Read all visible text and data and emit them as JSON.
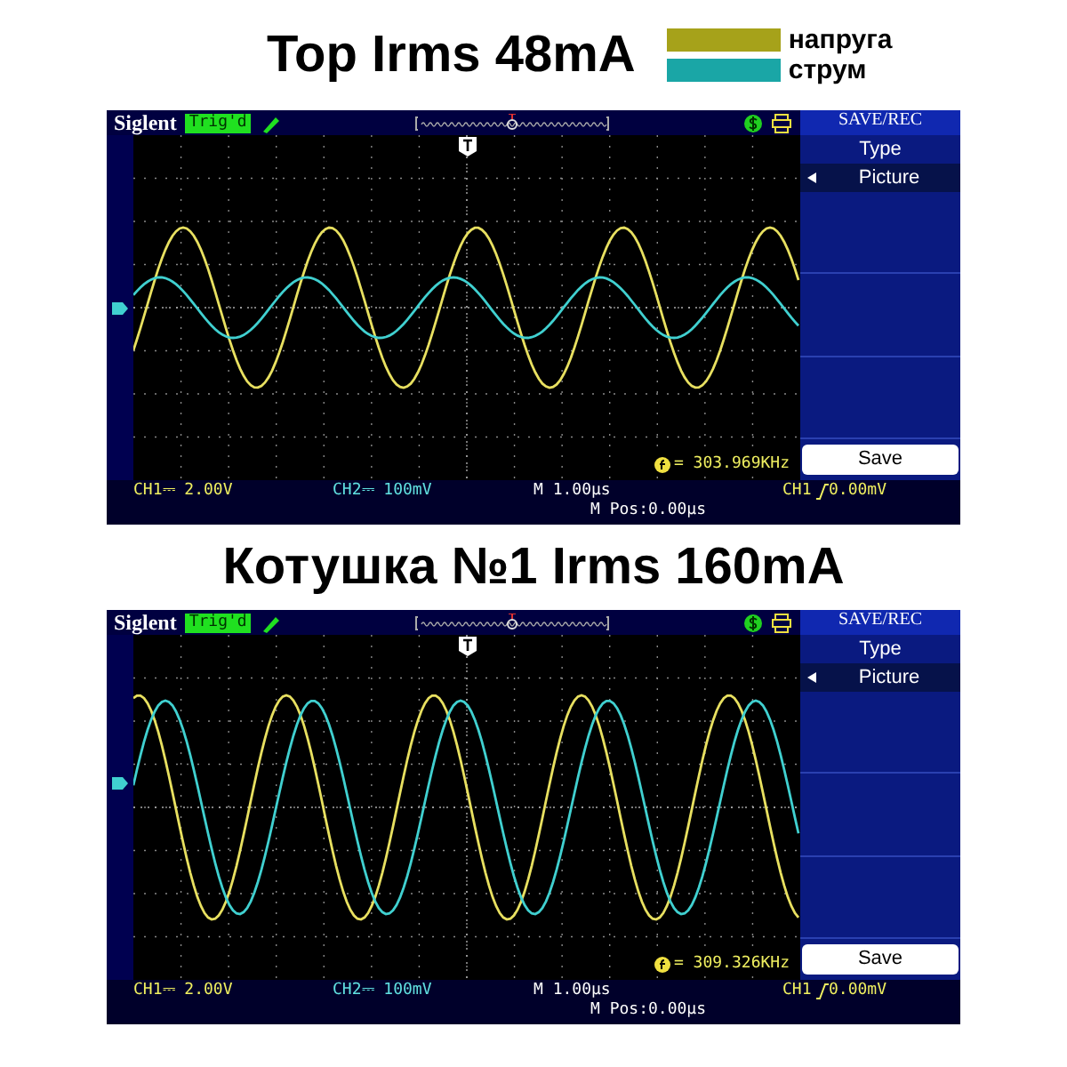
{
  "legend": [
    {
      "label": "напруга",
      "color": "#a6a21a"
    },
    {
      "label": "струм",
      "color": "#1aa6a6"
    }
  ],
  "scopes": [
    {
      "title": "Top Irms 48mA",
      "brand": "Siglent",
      "trigger_status": "Trig'd",
      "menu_title": "SAVE/REC",
      "menu_items": [
        {
          "label": "Type",
          "kind": "header"
        },
        {
          "label": "Picture",
          "kind": "option"
        }
      ],
      "menu_button": "Save",
      "frequency": "= 303.969KHz",
      "ch1": "CH1⎓ 2.00V",
      "ch2": "CH2⎓ 100mV",
      "timebase": "M 1.00μs",
      "trigger_source": "CH1",
      "trigger_level": "0.00mV",
      "position": "M Pos:0.00μs"
    },
    {
      "title": "Котушка №1 Irms 160mA",
      "brand": "Siglent",
      "trigger_status": "Trig'd",
      "menu_title": "SAVE/REC",
      "menu_items": [
        {
          "label": "Type",
          "kind": "header"
        },
        {
          "label": "Picture",
          "kind": "option"
        }
      ],
      "menu_button": "Save",
      "frequency": "= 309.326KHz",
      "ch1": "CH1⎓ 2.00V",
      "ch2": "CH2⎓ 100mV",
      "timebase": "M 1.00μs",
      "trigger_source": "CH1",
      "trigger_level": "0.00mV",
      "position": "M Pos:0.00μs"
    }
  ]
}
